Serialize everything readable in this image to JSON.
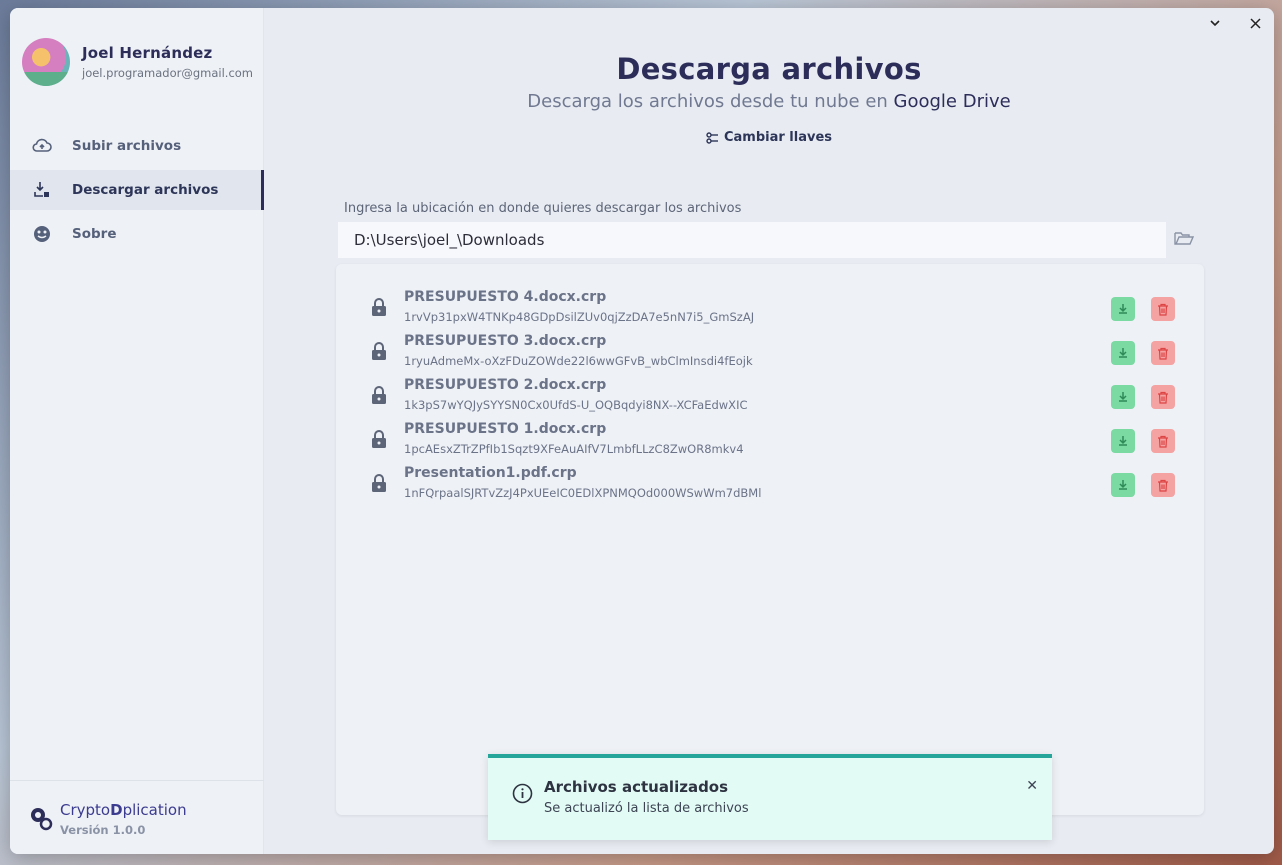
{
  "window": {
    "minimize_label": "⌄",
    "close_label": "✕"
  },
  "user": {
    "name": "Joel Hernández",
    "email": "joel.programador@gmail.com"
  },
  "sidebar": {
    "items": [
      {
        "label": "Subir archivos",
        "icon": "cloud-upload-icon",
        "active": false
      },
      {
        "label": "Descargar archivos",
        "icon": "download-icon",
        "active": true
      },
      {
        "label": "Sobre",
        "icon": "info-face-icon",
        "active": false
      }
    ]
  },
  "brand": {
    "name_part1": "Crypto",
    "name_part2": "D",
    "name_part3": "plication",
    "version": "Versión 1.0.0"
  },
  "header": {
    "title": "Descarga archivos",
    "subtitle_prefix": "Descarga los archivos desde tu nube en ",
    "subtitle_highlight": "Google Drive",
    "keys_button": "Cambiar llaves"
  },
  "location": {
    "label": "Ingresa la ubicación en donde quieres descargar los archivos",
    "value": "D:\\Users\\joel_\\Downloads"
  },
  "files": [
    {
      "name": "PRESUPUESTO 4.docx.crp",
      "id": "1rvVp31pxW4TNKp48GDpDsilZUv0qjZzDA7e5nN7i5_GmSzAJ"
    },
    {
      "name": "PRESUPUESTO 3.docx.crp",
      "id": "1ryuAdmeMx-oXzFDuZOWde22l6wwGFvB_wbClmInsdi4fEojk"
    },
    {
      "name": "PRESUPUESTO 2.docx.crp",
      "id": "1k3pS7wYQJySYYSN0Cx0UfdS-U_OQBqdyi8NX--XCFaEdwXIC"
    },
    {
      "name": "PRESUPUESTO 1.docx.crp",
      "id": "1pcAEsxZTrZPfIb1Sqzt9XFeAuAIfV7LmbfLLzC8ZwOR8mkv4"
    },
    {
      "name": "Presentation1.pdf.crp",
      "id": "1nFQrpaalSJRTvZzJ4PxUEeIC0EDlXPNMQOd000WSwWm7dBMl"
    }
  ],
  "toast": {
    "title": "Archivos actualizados",
    "message": "Se actualizó la lista de archivos",
    "close_label": "✕"
  },
  "colors": {
    "accent": "#2d2d5a",
    "download": "#7bd9a2",
    "delete": "#f5a2a2",
    "toast_border": "#26a69a",
    "toast_bg": "#e3fbf5"
  }
}
